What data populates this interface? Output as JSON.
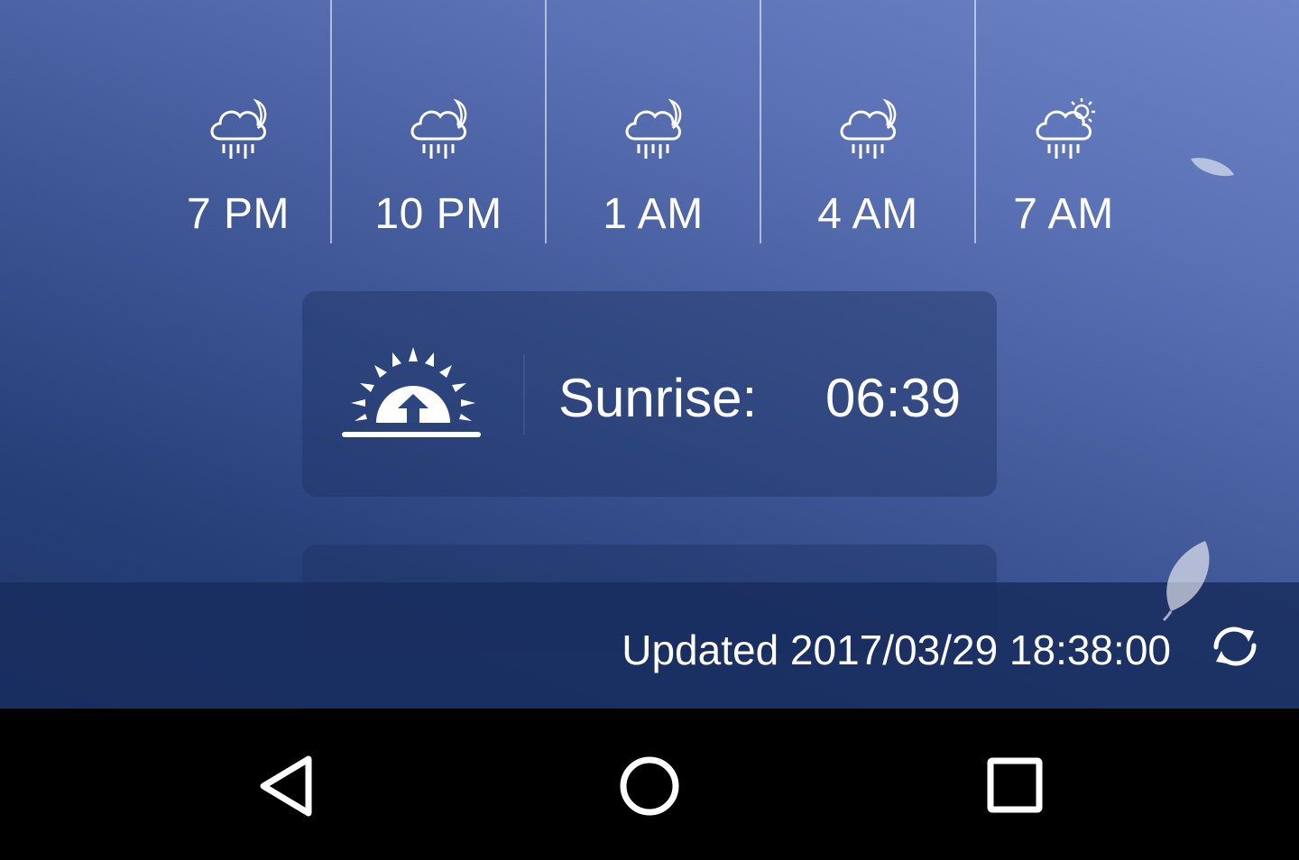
{
  "hourly": [
    {
      "time": "7 PM",
      "icon": "rain-night-icon"
    },
    {
      "time": "10 PM",
      "icon": "rain-night-icon"
    },
    {
      "time": "1 AM",
      "icon": "rain-night-icon"
    },
    {
      "time": "4 AM",
      "icon": "rain-night-icon"
    },
    {
      "time": "7 AM",
      "icon": "rain-day-icon"
    }
  ],
  "sun": {
    "label": "Sunrise:",
    "time": "06:39",
    "icon": "sunrise-icon"
  },
  "status": {
    "updated": "Updated 2017/03/29 18:38:00",
    "icon": "refresh-icon"
  },
  "nav": {
    "back": "back-icon",
    "home": "home-icon",
    "recent": "recent-apps-icon"
  },
  "colors": {
    "background_top": "#6d84c6",
    "background_bottom": "#1e3668",
    "text": "#ffffff"
  }
}
